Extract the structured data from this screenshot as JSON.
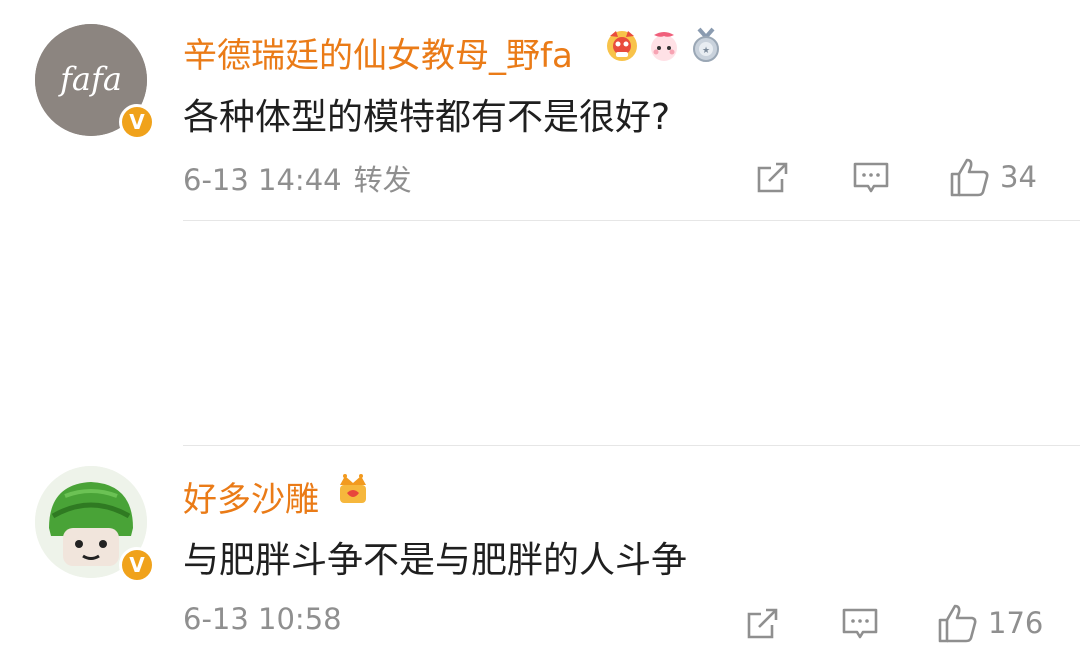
{
  "comments": [
    {
      "username": "辛德瑞廷的仙女教母_野fa",
      "avatar_text": "fafa",
      "verified_badge": "V",
      "medals": [
        "lion-dance-medal-icon",
        "bunny-medal-icon",
        "silver-medal-icon"
      ],
      "text": "各种体型的模特都有不是很好?",
      "time": "6-13 14:44",
      "repost_label": "转发",
      "likes": "34"
    },
    {
      "username": "好多沙雕",
      "avatar_text": "",
      "verified_badge": "V",
      "medals": [
        "crown-medal-icon"
      ],
      "text": "与肥胖斗争不是与肥胖的人斗争",
      "time": "6-13 10:58",
      "likes": "176"
    }
  ],
  "colors": {
    "username": "#ea7b17",
    "text": "#1f1f1f",
    "meta": "#8f8f8f",
    "badge": "#f0a21b"
  }
}
